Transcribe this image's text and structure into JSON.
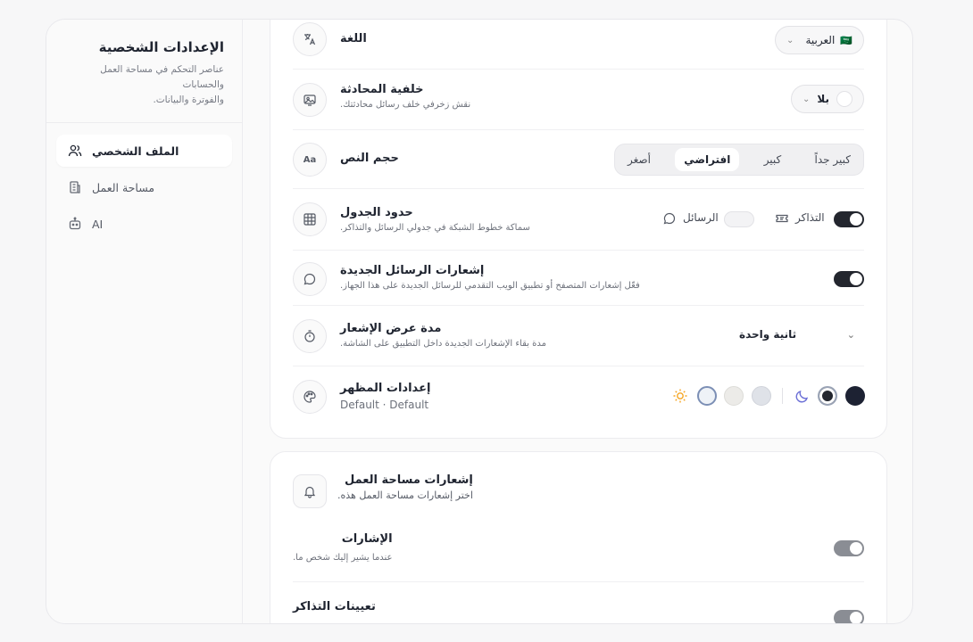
{
  "sidebar": {
    "title": "الإعدادات الشخصية",
    "desc_line1": "عناصر التحكم في مساحة العمل والحسابات",
    "desc_line2": "والفوترة والبيانات.",
    "items": [
      {
        "label": "الملف الشخصي",
        "icon": "users-icon",
        "active": true
      },
      {
        "label": "مساحة العمل",
        "icon": "building-icon",
        "active": false
      },
      {
        "label": "AI",
        "icon": "bot-icon",
        "active": false
      }
    ]
  },
  "personal": {
    "language": {
      "title": "اللغة",
      "value": "العربية",
      "flag": "🇸🇦"
    },
    "chat_background": {
      "title": "خلفية المحادثة",
      "subtitle": "نقش زخرفي خلف رسائل محادثتك.",
      "value": "بلا"
    },
    "text_size": {
      "title": "حجم النص",
      "options": [
        "كبير جداً",
        "كبير",
        "افتراضي",
        "أصغر"
      ],
      "selected": "افتراضي"
    },
    "table_borders": {
      "title": "حدود الجدول",
      "subtitle": "سماكة خطوط الشبكة في جدولي الرسائل والتذاكر.",
      "tickets_label": "التذاكر",
      "messages_label": "الرسائل",
      "tickets_on": true,
      "messages_on": false
    },
    "new_message_notifications": {
      "title": "إشعارات الرسائل الجديدة",
      "subtitle": "فعّل إشعارات المتصفح أو تطبيق الويب التقدمي للرسائل الجديدة على هذا الجهاز.",
      "on": true
    },
    "notification_duration": {
      "title": "مدة عرض الإشعار",
      "subtitle": "مدة بقاء الإشعارات الجديدة داخل التطبيق على الشاشة.",
      "value": "ثانية واحدة"
    },
    "appearance": {
      "title": "إعدادات المظهر",
      "subtitle": "Default · Default"
    }
  },
  "workspace_notifications": {
    "title": "إشعارات مساحة العمل",
    "subtitle": "اختر إشعارات مساحة العمل هذه.",
    "mentions": {
      "title": "الإشارات",
      "subtitle": "عندما يشير إليك شخص ما.",
      "on": true
    },
    "ticket_assignments": {
      "title": "تعيينات التذاكر",
      "on": true
    }
  },
  "colors": {
    "accent_dark": "#23262e",
    "toggle_grey": "#8a8d94",
    "sun": "#f5a623",
    "moon": "#6b6fd6"
  }
}
